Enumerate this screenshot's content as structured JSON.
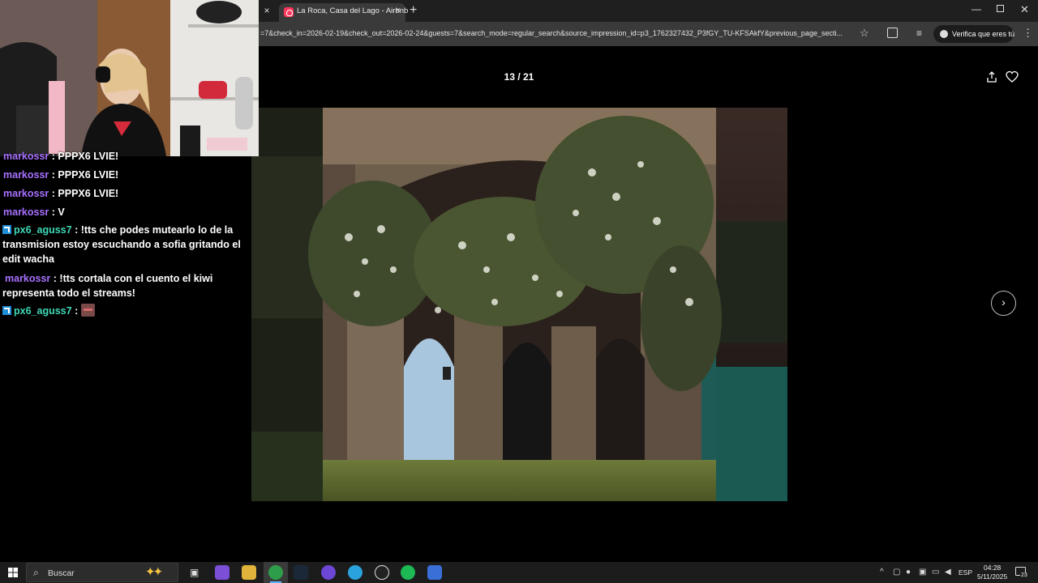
{
  "browser": {
    "prev_tab_close": "×",
    "tab_title": "La Roca, Casa del Lago - Airbnb",
    "tab_close": "×",
    "new_tab": "+",
    "url": "=7&check_in=2026-02-19&check_out=2026-02-24&guests=7&search_mode=regular_search&source_impression_id=p3_1762327432_P3fGY_TU-KFSAkfY&previous_page_secti...",
    "verify_label": "Verifica que eres tú",
    "win_min": "—",
    "win_close": "✕"
  },
  "gallery": {
    "counter": "13 / 21",
    "next_label": "›"
  },
  "chat": {
    "messages": [
      {
        "user": "markossr",
        "text": ": PPPX6 LVIE!"
      },
      {
        "user": "markossr",
        "text": ": PPPX6 LVIE!"
      },
      {
        "user": "markossr",
        "text": ": PPPX6 LVIE!"
      },
      {
        "user": "markossr",
        "text": ": V"
      },
      {
        "user": "px6_aguss7",
        "text": ": !tts che podes mutearlo lo de la transmision estoy escuchando a sofia gritando el edit wacha"
      },
      {
        "user": "markossr",
        "text": ": !tts cortala con el cuento el kiwi representa todo el streams!"
      },
      {
        "user": "px6_aguss7",
        "text": ":"
      }
    ]
  },
  "taskbar": {
    "search_placeholder": "Buscar",
    "language": "ESP",
    "time": "04:28",
    "date": "5/11/2025",
    "notification_count": "23"
  },
  "colors": {
    "airbnb_brand": "#ff385c",
    "chat_user_purple": "#a970ff",
    "chat_user_teal": "#3fd9b6"
  }
}
